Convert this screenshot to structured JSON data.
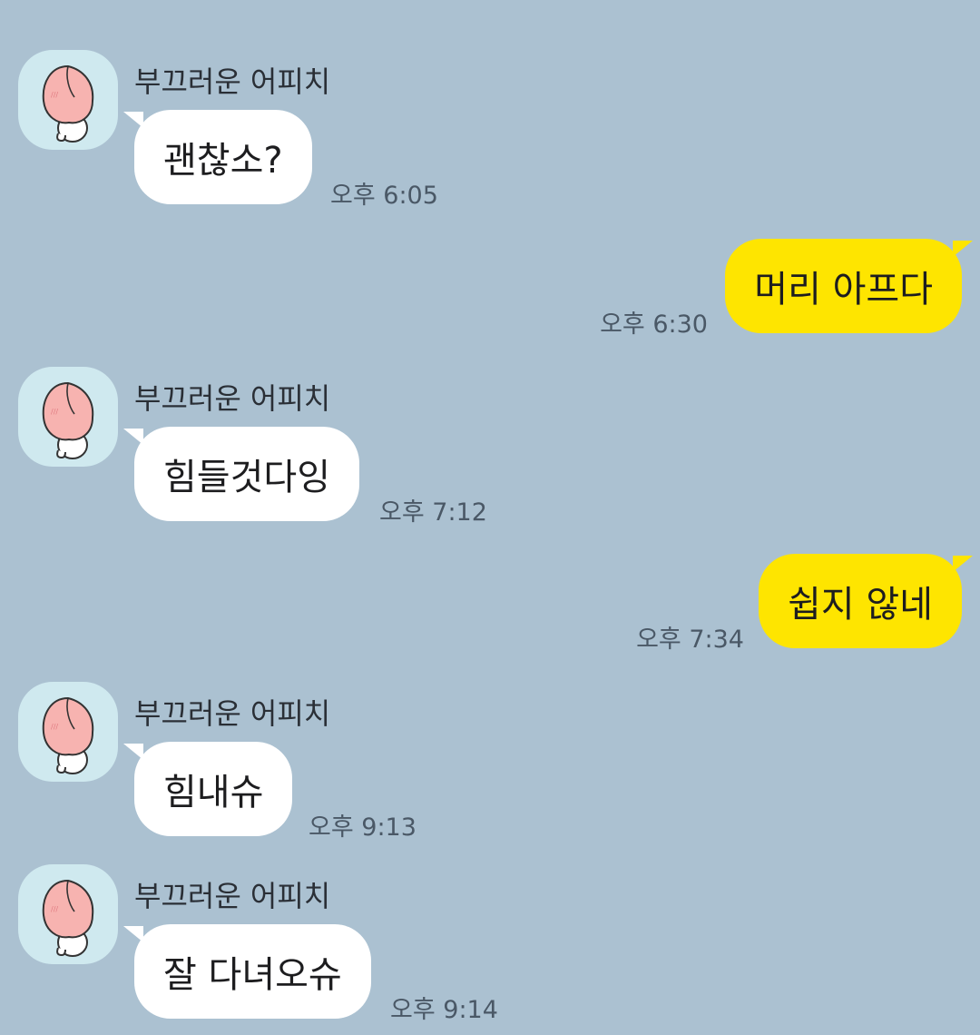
{
  "messages": [
    {
      "direction": "in",
      "sender": "부끄러운 어피치",
      "text": "괜찮소?",
      "time": "오후 6:05"
    },
    {
      "direction": "out",
      "text": "머리 아프다",
      "time": "오후 6:30"
    },
    {
      "direction": "in",
      "sender": "부끄러운 어피치",
      "text": "힘들것다잉",
      "time": "오후 7:12"
    },
    {
      "direction": "out",
      "text": "쉽지 않네",
      "time": "오후 7:34"
    },
    {
      "direction": "in",
      "sender": "부끄러운 어피치",
      "text": "힘내슈",
      "time": "오후 9:13"
    },
    {
      "direction": "in",
      "sender": "부끄러운 어피치",
      "text": "잘 다녀오슈",
      "time": "오후 9:14"
    }
  ],
  "colors": {
    "background": "#abc1d1",
    "incoming_bubble": "#ffffff",
    "outgoing_bubble": "#fee500"
  },
  "icons": {
    "avatar": "peach-character-avatar-icon"
  }
}
